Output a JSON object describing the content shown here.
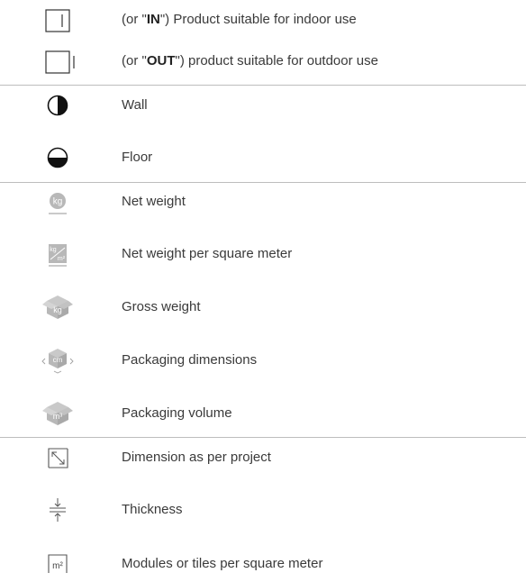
{
  "rows": [
    {
      "icon": "indoor-box-icon",
      "prefix": "(or \"",
      "bold": "IN",
      "suffix": "\") Product suitable for indoor use"
    },
    {
      "icon": "outdoor-box-icon",
      "prefix": "(or \"",
      "bold": "OUT",
      "suffix": "\") product suitable for outdoor use"
    },
    {
      "icon": "wall-half-circle-icon",
      "label": "Wall"
    },
    {
      "icon": "floor-half-circle-icon",
      "label": "Floor"
    },
    {
      "icon": "kg-weight-icon",
      "label": "Net weight"
    },
    {
      "icon": "kg-per-m2-icon",
      "label": "Net weight per square meter"
    },
    {
      "icon": "kg-box-icon",
      "label": "Gross weight"
    },
    {
      "icon": "cm-box-dimensions-icon",
      "label": "Packaging dimensions"
    },
    {
      "icon": "m3-box-icon",
      "label": "Packaging volume"
    },
    {
      "icon": "diagonal-arrow-box-icon",
      "label": "Dimension as per project"
    },
    {
      "icon": "thickness-arrows-icon",
      "label": "Thickness"
    },
    {
      "icon": "m2-box-icon",
      "label": "Modules or tiles per square meter"
    }
  ],
  "icon_text": {
    "kg": "kg",
    "kg_m2_top": "kg",
    "kg_m2_bottom": "m²",
    "cm": "cm",
    "m3": "m³",
    "m2": "m²"
  },
  "colors": {
    "divider": "#bdbdbd",
    "icon_gray": "#b8b8b8",
    "icon_dark": "#222222",
    "text": "#3a3a3a"
  }
}
